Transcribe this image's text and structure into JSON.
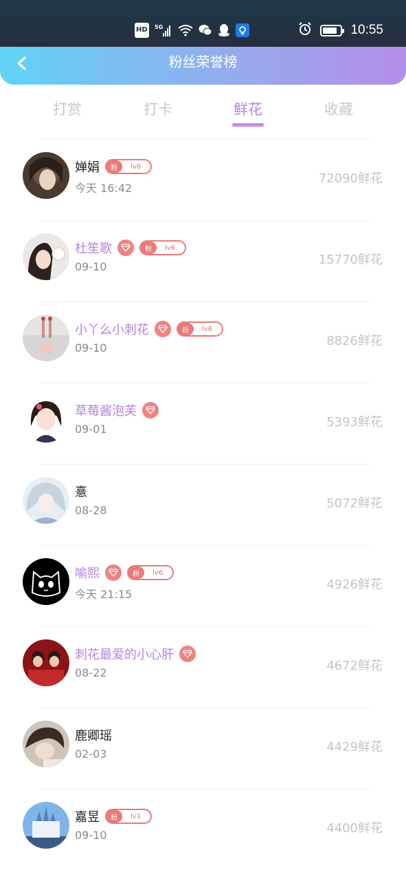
{
  "status_bar": {
    "hd_label": "HD",
    "net_label": "5G",
    "time": "10:55"
  },
  "header": {
    "title": "粉丝荣誉榜"
  },
  "tabs": [
    {
      "label": "打赏",
      "active": false
    },
    {
      "label": "打卡",
      "active": false
    },
    {
      "label": "鲜花",
      "active": true
    },
    {
      "label": "收藏",
      "active": false
    }
  ],
  "badge_fan_label": "粉",
  "list": [
    {
      "name": "婵娟",
      "vip": false,
      "diamond": false,
      "level": "lv6",
      "time": "今天 16:42",
      "count": "72090鲜花"
    },
    {
      "name": "杜笙歌",
      "vip": true,
      "diamond": true,
      "level": "lv6",
      "time": "09-10",
      "count": "15770鲜花"
    },
    {
      "name": "小丫么小刺花",
      "vip": true,
      "diamond": true,
      "level": "lv6",
      "time": "09-10",
      "count": "8826鲜花"
    },
    {
      "name": "草莓酱泡芙",
      "vip": true,
      "diamond": true,
      "level": "",
      "time": "09-01",
      "count": "5393鲜花"
    },
    {
      "name": "憙",
      "vip": false,
      "diamond": false,
      "level": "",
      "time": "08-28",
      "count": "5072鲜花"
    },
    {
      "name": "喻熙",
      "vip": true,
      "diamond": true,
      "level": "lv6",
      "time": "今天 21:15",
      "count": "4926鲜花"
    },
    {
      "name": "刺花最爱的小心肝",
      "vip": true,
      "diamond": true,
      "level": "",
      "time": "08-22",
      "count": "4672鲜花"
    },
    {
      "name": "鹿卿瑶",
      "vip": false,
      "diamond": false,
      "level": "",
      "time": "02-03",
      "count": "4429鲜花"
    },
    {
      "name": "嘉昱",
      "vip": false,
      "diamond": false,
      "level": "lv1",
      "time": "09-10",
      "count": "4400鲜花"
    }
  ],
  "colors": {
    "accent": "#b483e0",
    "badge": "#ec7878"
  }
}
